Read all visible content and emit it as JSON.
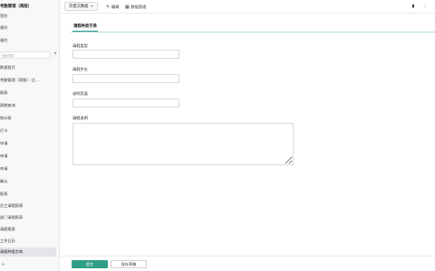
{
  "sidebar": {
    "app_title": "考勤管理（简版）",
    "top_items": [
      {
        "label": "签约"
      },
      {
        "label": "规约"
      },
      {
        "label": "规约"
      }
    ],
    "search_placeholder": "搜索表单",
    "add_icon": "plus-icon",
    "items": [
      {
        "label": "数据首页",
        "active": false
      },
      {
        "label": "考勤管理（简版）-企…",
        "active": false
      },
      {
        "label": "报表",
        "active": false
      },
      {
        "label": "周期查询",
        "active": false
      },
      {
        "label": "统计表",
        "active": false
      },
      {
        "label": "打卡",
        "active": false
      },
      {
        "label": "申请",
        "active": false
      },
      {
        "label": "申请",
        "active": false
      },
      {
        "label": "申请",
        "active": false
      },
      {
        "label": "确认",
        "active": false
      },
      {
        "label": "报表",
        "active": false
      },
      {
        "label": "员工请假报表",
        "active": false
      },
      {
        "label": "部门请假报表",
        "active": false
      },
      {
        "label": "请假报表",
        "active": false
      },
      {
        "label": "工作日历",
        "active": false
      },
      {
        "label": "请假种类字典",
        "active": true
      }
    ],
    "collapse_icon": "collapse-icon"
  },
  "topbar": {
    "view_selector": "仅提交数据",
    "edit_label": "编辑",
    "manage_label": "数据管理",
    "right_icons": [
      "file-icon",
      "more-icon"
    ]
  },
  "tab": {
    "label": "请假种类字典"
  },
  "form": {
    "fields": [
      {
        "label": "请假类型",
        "value": ""
      },
      {
        "label": "请假步长",
        "value": ""
      },
      {
        "label": "说明页面",
        "value": ""
      }
    ],
    "textarea": {
      "label": "请假说明",
      "value": ""
    }
  },
  "footer": {
    "submit_label": "提交",
    "save_draft_label": "保存草稿"
  },
  "colors": {
    "accent": "#2f9e87",
    "sidebar_bg": "#f7f8fa",
    "active_item_bg": "#e3e5e8"
  }
}
